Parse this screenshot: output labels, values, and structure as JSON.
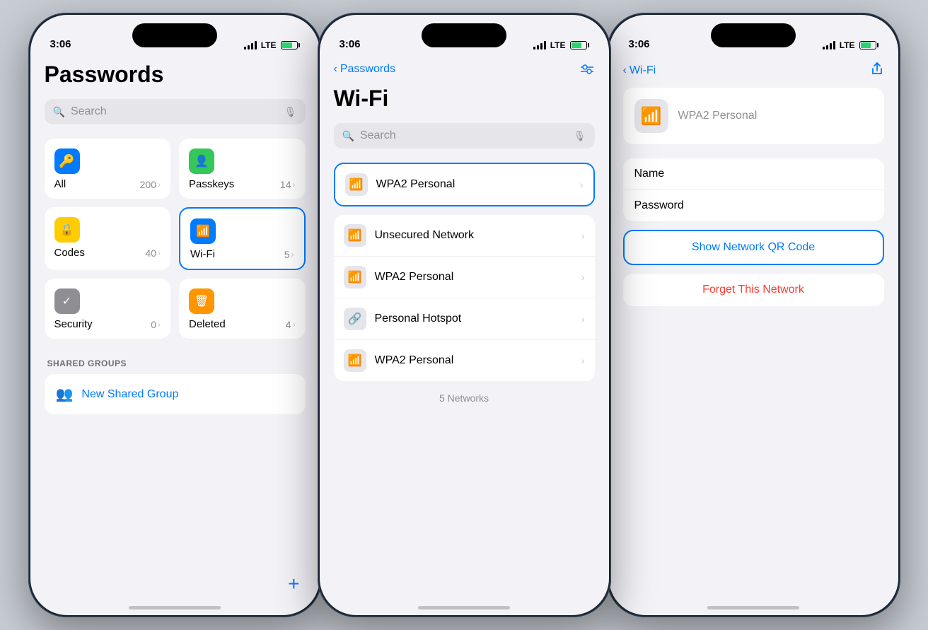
{
  "phone1": {
    "status": {
      "time": "3:06",
      "signal": "●●●●",
      "lte": "LTE",
      "battery": "70"
    },
    "title": "Passwords",
    "search": {
      "placeholder": "Search"
    },
    "categories": [
      {
        "id": "all",
        "icon": "🔑",
        "icon_class": "icon-blue",
        "name": "All",
        "count": "200"
      },
      {
        "id": "passkeys",
        "icon": "👤",
        "icon_class": "icon-green",
        "name": "Passkeys",
        "count": "14"
      },
      {
        "id": "codes",
        "icon": "🔒",
        "icon_class": "icon-yellow",
        "name": "Codes",
        "count": "40"
      },
      {
        "id": "wifi",
        "icon": "📶",
        "icon_class": "icon-blue",
        "name": "Wi-Fi",
        "count": "5",
        "selected": true
      },
      {
        "id": "security",
        "icon": "✓",
        "icon_class": "icon-gray",
        "name": "Security",
        "count": "0"
      },
      {
        "id": "deleted",
        "icon": "🗑",
        "icon_class": "icon-orange",
        "name": "Deleted",
        "count": "4"
      }
    ],
    "shared_groups": {
      "label": "SHARED GROUPS",
      "new_group_label": "New Shared Group"
    },
    "add_button": "+"
  },
  "phone2": {
    "status": {
      "time": "3:06",
      "signal": "●●●●",
      "lte": "LTE",
      "battery": "70"
    },
    "nav": {
      "back_label": "Passwords",
      "right_icon": "filter"
    },
    "title": "Wi-Fi",
    "search": {
      "placeholder": "Search"
    },
    "networks": [
      {
        "name": "WPA2 Personal",
        "type": "wifi",
        "selected": true
      },
      {
        "name": "Unsecured Network",
        "type": "wifi"
      },
      {
        "name": "WPA2 Personal",
        "type": "wifi"
      },
      {
        "name": "Personal Hotspot",
        "type": "hotspot"
      },
      {
        "name": "WPA2 Personal",
        "type": "wifi"
      }
    ],
    "footer": "5 Networks"
  },
  "phone3": {
    "status": {
      "time": "3:06",
      "signal": "●●●●",
      "lte": "LTE",
      "battery": "70"
    },
    "nav": {
      "back_label": "Wi-Fi",
      "right_icon": "share"
    },
    "network_name": "WPA2 Personal",
    "info_rows": [
      {
        "label": "Name"
      },
      {
        "label": "Password"
      }
    ],
    "qr_button": "Show Network QR Code",
    "danger_button": "Forget This Network"
  }
}
